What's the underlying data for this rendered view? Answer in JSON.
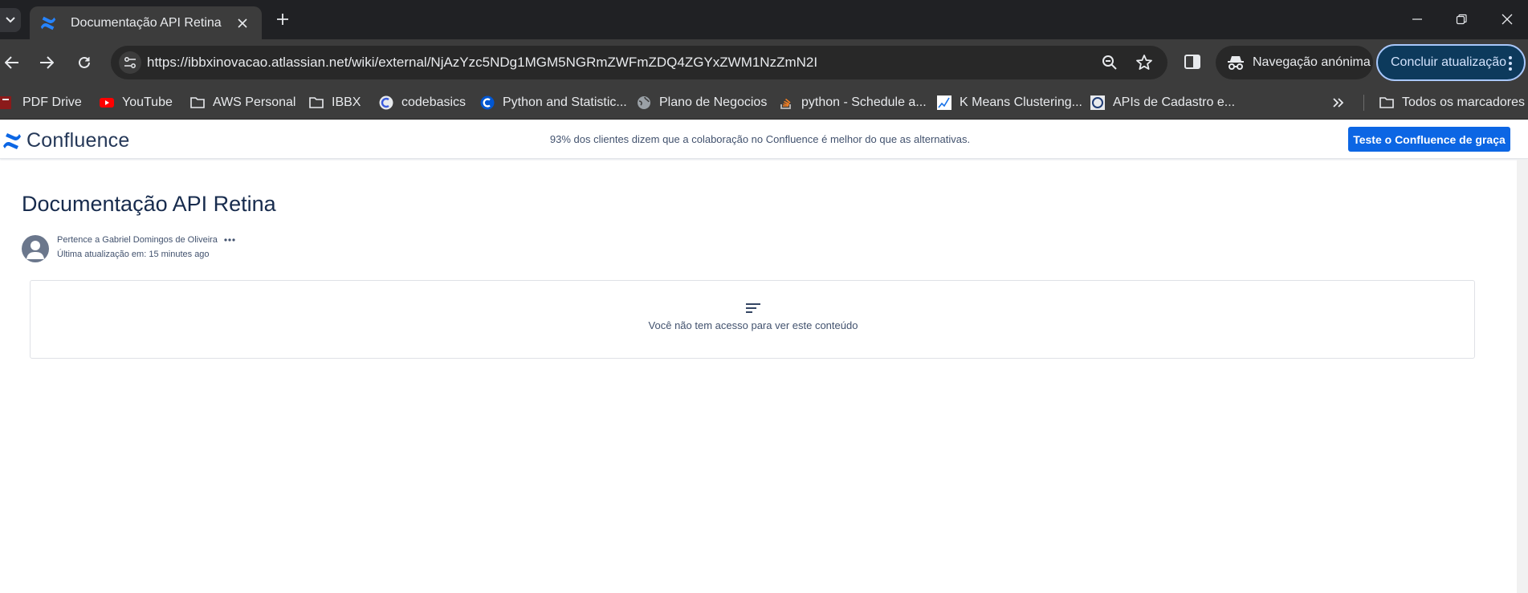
{
  "browser": {
    "tab": {
      "title": "Documentação API Retina"
    },
    "address_bar": {
      "url": "https://ibbxinovacao.atlassian.net/wiki/external/NjAzYzc5NDg1MGM5NGRmZWFmZDQ4ZGYxZWM1NzZmN2I"
    },
    "incognito_label": "Navegação anónima",
    "update_label": "Concluir atualização",
    "bookmarks": [
      {
        "label": "PDF Drive",
        "icon": "pdf-icon"
      },
      {
        "label": "YouTube",
        "icon": "youtube-icon"
      },
      {
        "label": "AWS Personal",
        "icon": "folder-icon"
      },
      {
        "label": "IBBX",
        "icon": "folder-icon"
      },
      {
        "label": "codebasics",
        "icon": "codebasics-icon"
      },
      {
        "label": "Python and Statistic...",
        "icon": "coursera-icon"
      },
      {
        "label": "Plano de Negocios",
        "icon": "globe-icon"
      },
      {
        "label": "python - Schedule a...",
        "icon": "stackoverflow-icon"
      },
      {
        "label": "K Means Clustering...",
        "icon": "chart-icon"
      },
      {
        "label": "APIs de Cadastro e...",
        "icon": "site-icon"
      }
    ],
    "all_bookmarks_label": "Todos os marcadores"
  },
  "confluence": {
    "brand": "Confluence",
    "promo": "93% dos clientes dizem que a colaboração no Confluence é melhor do que as alternativas.",
    "cta": "Teste o Confluence de graça",
    "colors": {
      "accent": "#0c66e4",
      "title": "#172b4d"
    }
  },
  "document": {
    "title": "Documentação API Retina",
    "owner": "Pertence a Gabriel Domingos de Oliveira",
    "updated": "Última atualização em: 15 minutes ago",
    "no_access_message": "Você não tem acesso para ver este conteúdo"
  }
}
